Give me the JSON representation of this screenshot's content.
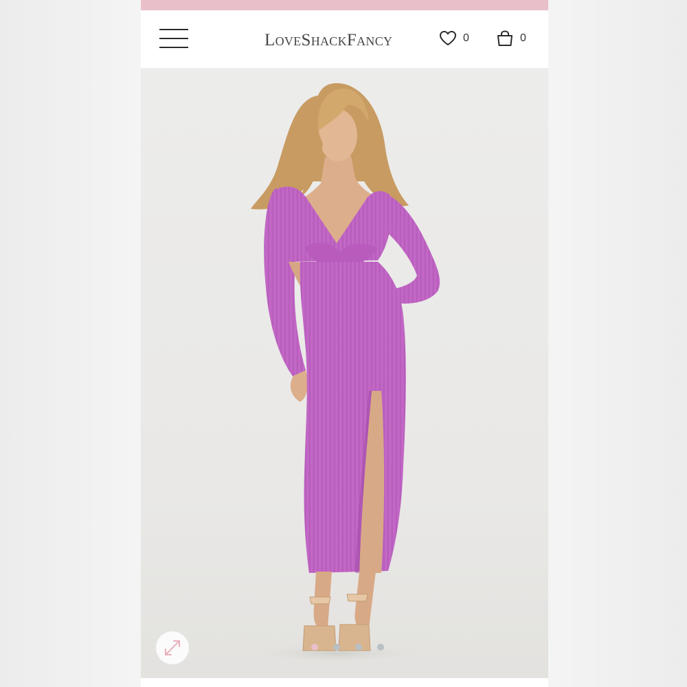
{
  "colors": {
    "promo_strip": "#e9bfca",
    "header_bg": "#ffffff",
    "dress": "#c667c9",
    "dress_shadow": "#a84aae",
    "dot_active": "#e9bfca",
    "dot_inactive": "#b9c0c4",
    "zoom_icon": "#e9aebc"
  },
  "header": {
    "logo": "LoveShackFancy",
    "menu_icon": "hamburger-menu-icon",
    "wishlist": {
      "icon": "heart-icon",
      "count": "0"
    },
    "cart": {
      "icon": "shopping-bag-icon",
      "count": "0"
    }
  },
  "hero": {
    "subject": "model wearing pink ribbed knit midi dress with twist front and waist cutouts",
    "zoom_icon": "expand-arrows-icon",
    "carousel": {
      "total": 4,
      "active": 0
    }
  }
}
